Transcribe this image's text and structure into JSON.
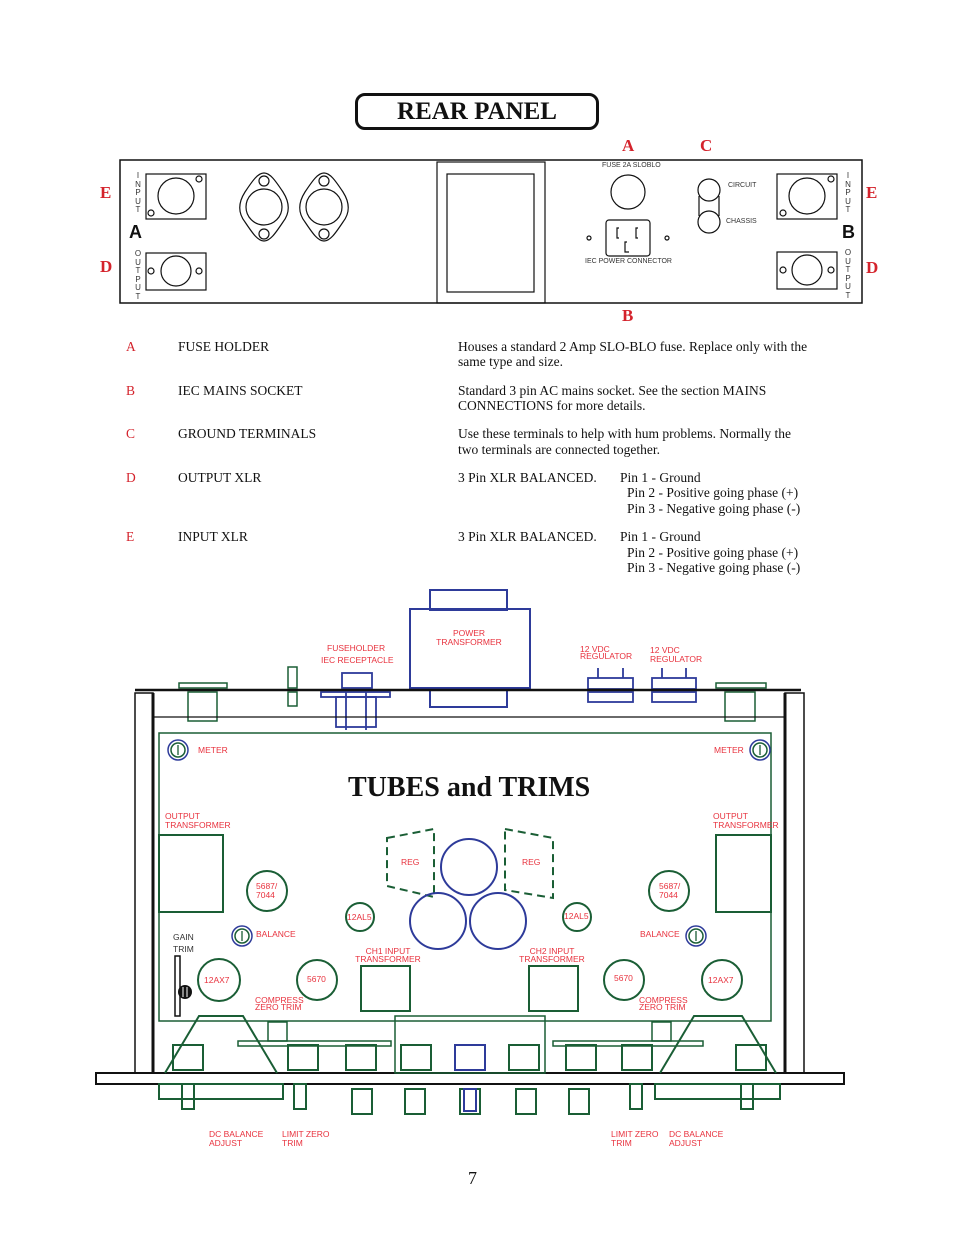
{
  "rear_panel": {
    "title": "REAR PANEL",
    "callouts": {
      "A_top": "A",
      "C_top": "C",
      "B_bottom": "B",
      "E_left": "E",
      "D_left": "D",
      "E_right": "E",
      "D_right": "D"
    },
    "channel_a": "A",
    "channel_b": "B",
    "input_label": [
      "I",
      "N",
      "P",
      "U",
      "T"
    ],
    "output_label": [
      "O",
      "U",
      "T",
      "P",
      "U",
      "T"
    ],
    "fuse_label": "FUSE 2A SLOBLO",
    "iec_label": "IEC POWER CONNECTOR",
    "circuit_label": "CIRCUIT",
    "chassis_label": "CHASSIS"
  },
  "legend": [
    {
      "letter": "A",
      "name": "FUSE HOLDER",
      "desc": [
        "Houses a standard 2 Amp SLO-BLO fuse.  Replace only with the",
        "same type and size."
      ]
    },
    {
      "letter": "B",
      "name": "IEC MAINS SOCKET",
      "desc": [
        "Standard 3 pin AC mains socket.  See the section MAINS",
        "CONNECTIONS for more details."
      ]
    },
    {
      "letter": "C",
      "name": "GROUND TERMINALS",
      "desc": [
        "Use these terminals to help with hum problems. Normally the",
        "two terminals are connected together."
      ]
    },
    {
      "letter": "D",
      "name": "OUTPUT XLR",
      "desc": [
        "3 Pin XLR BALANCED.",
        "Pin 1 - Ground",
        "Pin 2 - Positive going phase (+)",
        "Pin 3 - Negative going phase (-)"
      ]
    },
    {
      "letter": "E",
      "name": "INPUT XLR",
      "desc": [
        "3 Pin XLR BALANCED.",
        "Pin 1 - Ground",
        "Pin 2 - Positive going phase (+)",
        "Pin 3 - Negative going phase (-)"
      ]
    }
  ],
  "tubes": {
    "title": "TUBES and TRIMS",
    "labels": {
      "fuseholder": "FUSEHOLDER",
      "iec_receptacle": "IEC RECEPTACLE",
      "power_transformer": [
        "POWER",
        "TRANSFORMER"
      ],
      "regulator_1": [
        "12 VDC",
        "REGULATOR"
      ],
      "regulator_2": [
        "12 VDC",
        "REGULATOR"
      ],
      "meter_left": "METER",
      "meter_right": "METER",
      "output_transformer_left": [
        "OUTPUT",
        "TRANSFORMER"
      ],
      "output_transformer_right": [
        "OUTPUT",
        "TRANSFORMER"
      ],
      "reg_left": "REG",
      "reg_right": "REG",
      "tube_5687_left": [
        "5687/",
        "7044"
      ],
      "tube_5687_right": [
        "5687/",
        "7044"
      ],
      "tube_12al5_left": "12AL5",
      "tube_12al5_right": "12AL5",
      "gain_trim": [
        "GAIN",
        "TRIM"
      ],
      "balance_left": "BALANCE",
      "balance_right": "BALANCE",
      "ch1_input": [
        "CH1 INPUT",
        "TRANSFORMER"
      ],
      "ch2_input": [
        "CH2 INPUT",
        "TRANSFORMER"
      ],
      "tube_12ax7_left": "12AX7",
      "tube_12ax7_right": "12AX7",
      "tube_5670_left": "5670",
      "tube_5670_right": "5670",
      "compress_left": [
        "COMPRESS",
        "ZERO TRIM"
      ],
      "compress_right": [
        "COMPRESS",
        "ZERO TRIM"
      ],
      "dc_balance_left": [
        "DC BALANCE",
        "ADJUST"
      ],
      "limit_zero_left": [
        "LIMIT ZERO",
        "TRIM"
      ],
      "limit_zero_right": [
        "LIMIT ZERO",
        "TRIM"
      ],
      "dc_balance_right": [
        "DC BALANCE",
        "ADJUST"
      ]
    }
  },
  "colors": {
    "callout_red": "#d4232c",
    "label_red": "#e8323e",
    "green": "#1a5e35",
    "blue": "#2e3b9a"
  },
  "page_number": "7"
}
